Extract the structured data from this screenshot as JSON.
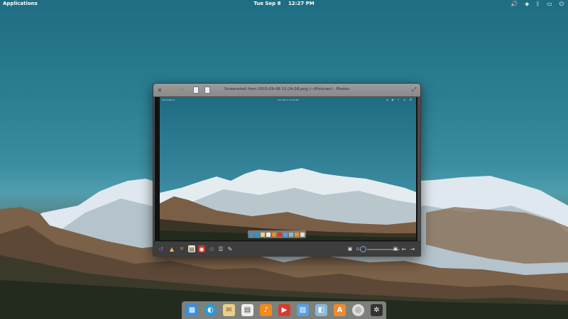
{
  "panel": {
    "applications_label": "Applications",
    "date": "Tue Sep 8",
    "time": "12:27 PM",
    "indicators": [
      {
        "name": "volume-icon",
        "glyph": "🔊"
      },
      {
        "name": "network-icon",
        "glyph": "◈"
      },
      {
        "name": "bluetooth-icon",
        "glyph": "ᛒ"
      },
      {
        "name": "notifications-icon",
        "glyph": "▭"
      },
      {
        "name": "power-icon",
        "glyph": "⏻"
      }
    ]
  },
  "window": {
    "title": "Screenshot from 2015-09-08 12:24:58.png (~/Pictures) - Photos",
    "inner_screenshot": {
      "panel_left": "Applications",
      "panel_center": "Tue Sep 8   12:24 PM",
      "panel_right": "◂ ◈ ⚡ ▭ ⏻"
    }
  },
  "dock": {
    "items": [
      {
        "name": "multitasking-view-icon",
        "color": "#3a8fdc"
      },
      {
        "name": "web-browser-icon",
        "color": "#2a9ad4"
      },
      {
        "name": "mail-icon",
        "color": "#e9d08a"
      },
      {
        "name": "calendar-icon",
        "color": "#eeeeee"
      },
      {
        "name": "music-icon",
        "color": "#f28a1d"
      },
      {
        "name": "videos-icon",
        "color": "#d83a2e"
      },
      {
        "name": "photos-icon",
        "color": "#5a9ee0"
      },
      {
        "name": "system-settings-icon",
        "color": "#8bb8d8"
      },
      {
        "name": "app-center-icon",
        "color": "#f08a30"
      },
      {
        "name": "optical-disc-icon",
        "color": "#dcdcdc"
      },
      {
        "name": "screenshot-settings-icon",
        "color": "#333333"
      }
    ]
  },
  "colors": {
    "accent_blue": "#2a7d93",
    "window_titlebar": "#8f8f8f",
    "window_toolbar": "#3d3d3d"
  }
}
